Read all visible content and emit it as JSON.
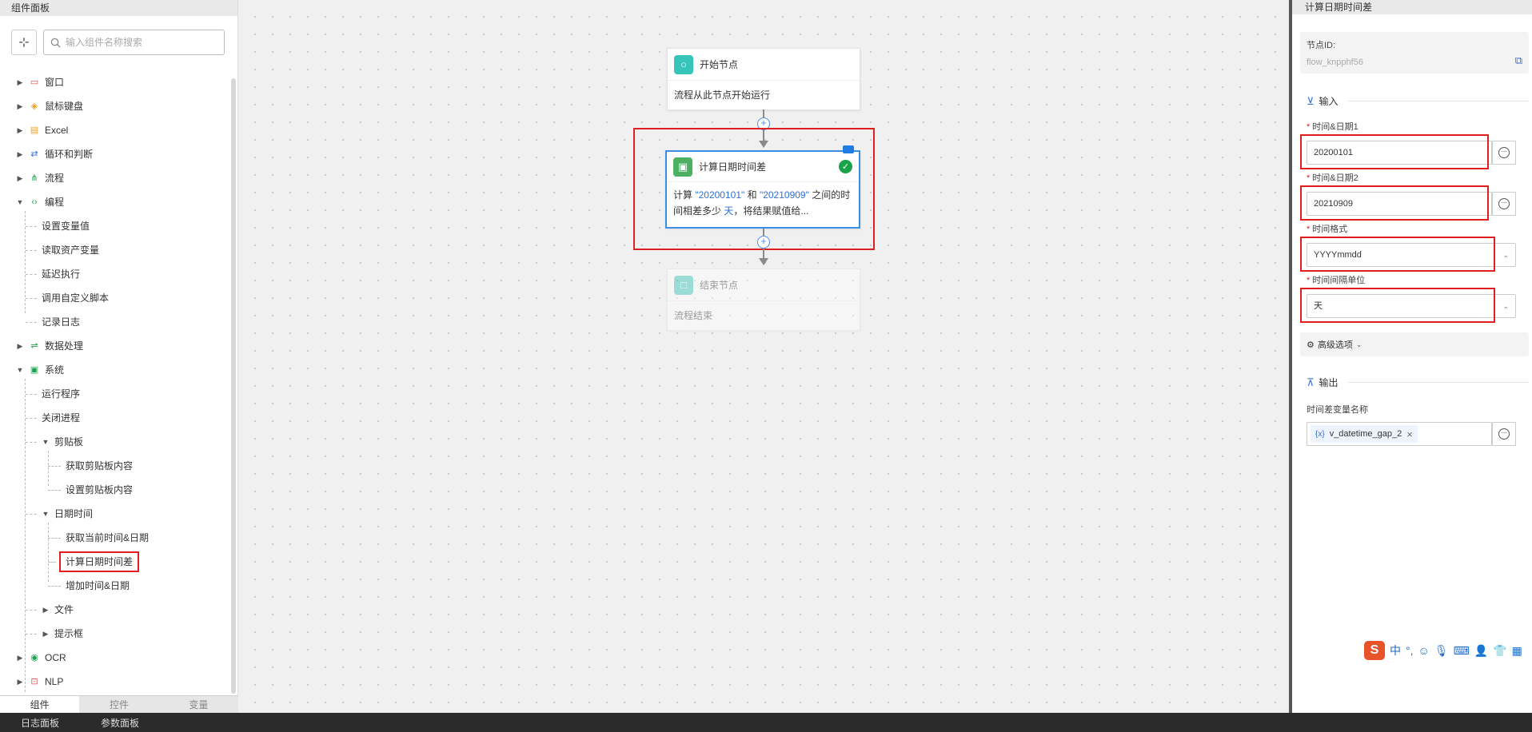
{
  "left_panel": {
    "title": "组件面板",
    "search_placeholder": "输入组件名称搜索",
    "categories": [
      {
        "label": "窗口",
        "icon": "window-icon",
        "color": "#e05050"
      },
      {
        "label": "鼠标键盘",
        "icon": "mouse-keyboard-icon",
        "color": "#f0a020"
      },
      {
        "label": "Excel",
        "icon": "excel-icon",
        "color": "#f0a020"
      },
      {
        "label": "循环和判断",
        "icon": "loop-icon",
        "color": "#2f6fd6"
      },
      {
        "label": "流程",
        "icon": "flow-icon",
        "color": "#1aa34a"
      },
      {
        "label": "编程",
        "icon": "code-icon",
        "color": "#1aa34a"
      },
      {
        "label": "数据处理",
        "icon": "data-processing-icon",
        "color": "#1aa34a"
      },
      {
        "label": "系统",
        "icon": "system-icon",
        "color": "#1aa34a"
      },
      {
        "label": "OCR",
        "icon": "ocr-icon",
        "color": "#1aa34a"
      },
      {
        "label": "NLP",
        "icon": "nlp-icon",
        "color": "#e05050"
      }
    ],
    "programming_items": [
      "设置变量值",
      "读取资产变量",
      "延迟执行",
      "调用自定义脚本",
      "记录日志"
    ],
    "system_items": [
      "运行程序",
      "关闭进程"
    ],
    "clipboard": {
      "label": "剪贴板",
      "items": [
        "获取剪贴板内容",
        "设置剪贴板内容"
      ]
    },
    "datetime": {
      "label": "日期时间",
      "items": [
        "获取当前时间&日期",
        "计算日期时间差",
        "增加时间&日期"
      ]
    },
    "file_label": "文件",
    "prompt_label": "提示框",
    "tabs": [
      "组件",
      "控件",
      "变量"
    ]
  },
  "canvas": {
    "start_node": {
      "title": "开始节点",
      "body": "流程从此节点开始运行"
    },
    "calc_node": {
      "title": "计算日期时间差",
      "body_prefix": "计算 ",
      "value1": "\"20200101\"",
      "body_and": " 和 ",
      "value2": "\"20210909\"",
      "body_mid": " 之间的时间相差多少 ",
      "unit": "天",
      "body_suffix": "，将结果赋值给..."
    },
    "end_node": {
      "title": "结束节点",
      "body": "流程结束"
    }
  },
  "right_panel": {
    "title": "计算日期时间差",
    "node_id_label": "节点ID:",
    "node_id_value": "flow_knpphf56",
    "input_section": "输入",
    "field1_label": "时间&日期1",
    "field1_value": "20200101",
    "field2_label": "时间&日期2",
    "field2_value": "20210909",
    "format_label": "时间格式",
    "format_value": "YYYYmmdd",
    "unit_label": "时间间隔单位",
    "unit_value": "天",
    "advanced_label": "高级选项",
    "output_section": "输出",
    "output_label": "时间差变量名称",
    "output_var": "v_datetime_gap_2",
    "output_var_prefix": "{x}"
  },
  "ime": {
    "lang": "中",
    "punct": "°,"
  },
  "footer": {
    "log_panel": "日志面板",
    "param_panel": "参数面板"
  },
  "colors": {
    "accent": "#2f6fd6",
    "highlight": "#e02020",
    "success": "#1aa34a"
  }
}
